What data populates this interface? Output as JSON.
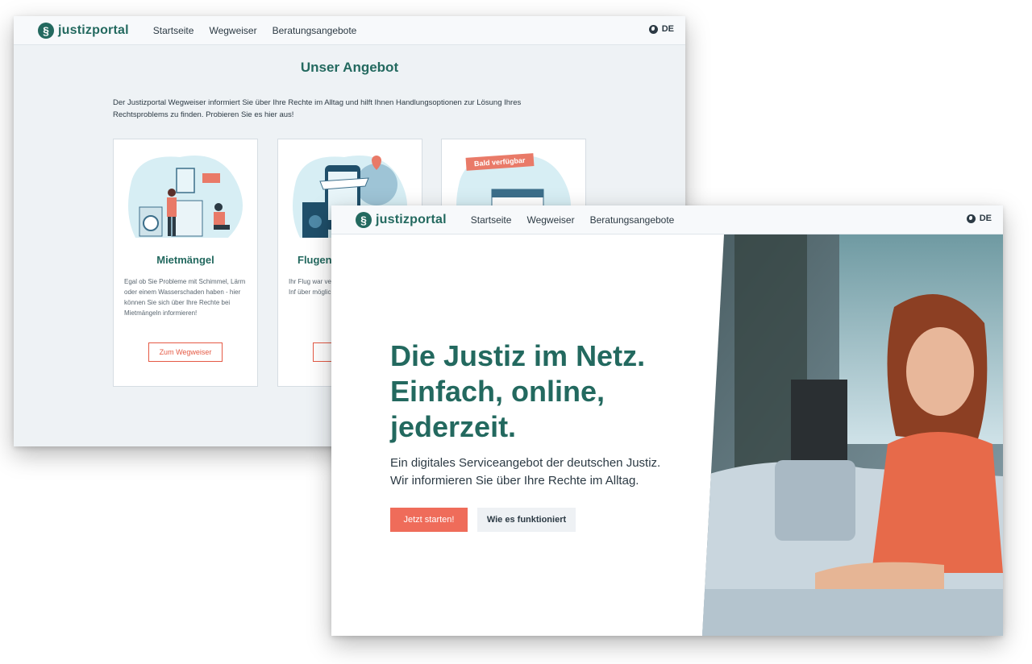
{
  "back": {
    "logo": "justizportal",
    "nav": [
      "Startseite",
      "Wegweiser",
      "Beratungsangebote"
    ],
    "lang": "DE",
    "section_title": "Unser Angebot",
    "intro": "Der Justizportal Wegweiser informiert Sie über Ihre Rechte im Alltag und hilft Ihnen Handlungsoptionen zur Lösung Ihres Rechtsproblems zu finden. Probieren Sie es hier aus!",
    "cards": [
      {
        "title": "Mietmängel",
        "text": "Egal ob Sie Probleme mit Schimmel, Lärm oder einem Wasserschaden haben - hier können Sie sich über Ihre Rechte bei Mietmängeln informieren!",
        "button": "Zum Wegweiser"
      },
      {
        "title": "Flugent",
        "text": "Ihr Flug war ve oder Ihnen wu verweigert? Inf über mögliche Fluggastrechte",
        "button": "Zu"
      },
      {
        "badge": "Bald verfügbar"
      }
    ]
  },
  "front": {
    "logo": "justizportal",
    "nav": [
      "Startseite",
      "Wegweiser",
      "Beratungsangebote"
    ],
    "lang": "DE",
    "headline": "Die Justiz im Netz. Einfach, online, jederzeit.",
    "subline": "Ein digitales Serviceangebot der deutschen Justiz. Wir informieren Sie über Ihre Rechte im Alltag.",
    "primary_button": "Jetzt starten!",
    "secondary_button": "Wie es funktioniert"
  },
  "colors": {
    "brand": "#23695f",
    "accent": "#ef6c5a"
  }
}
